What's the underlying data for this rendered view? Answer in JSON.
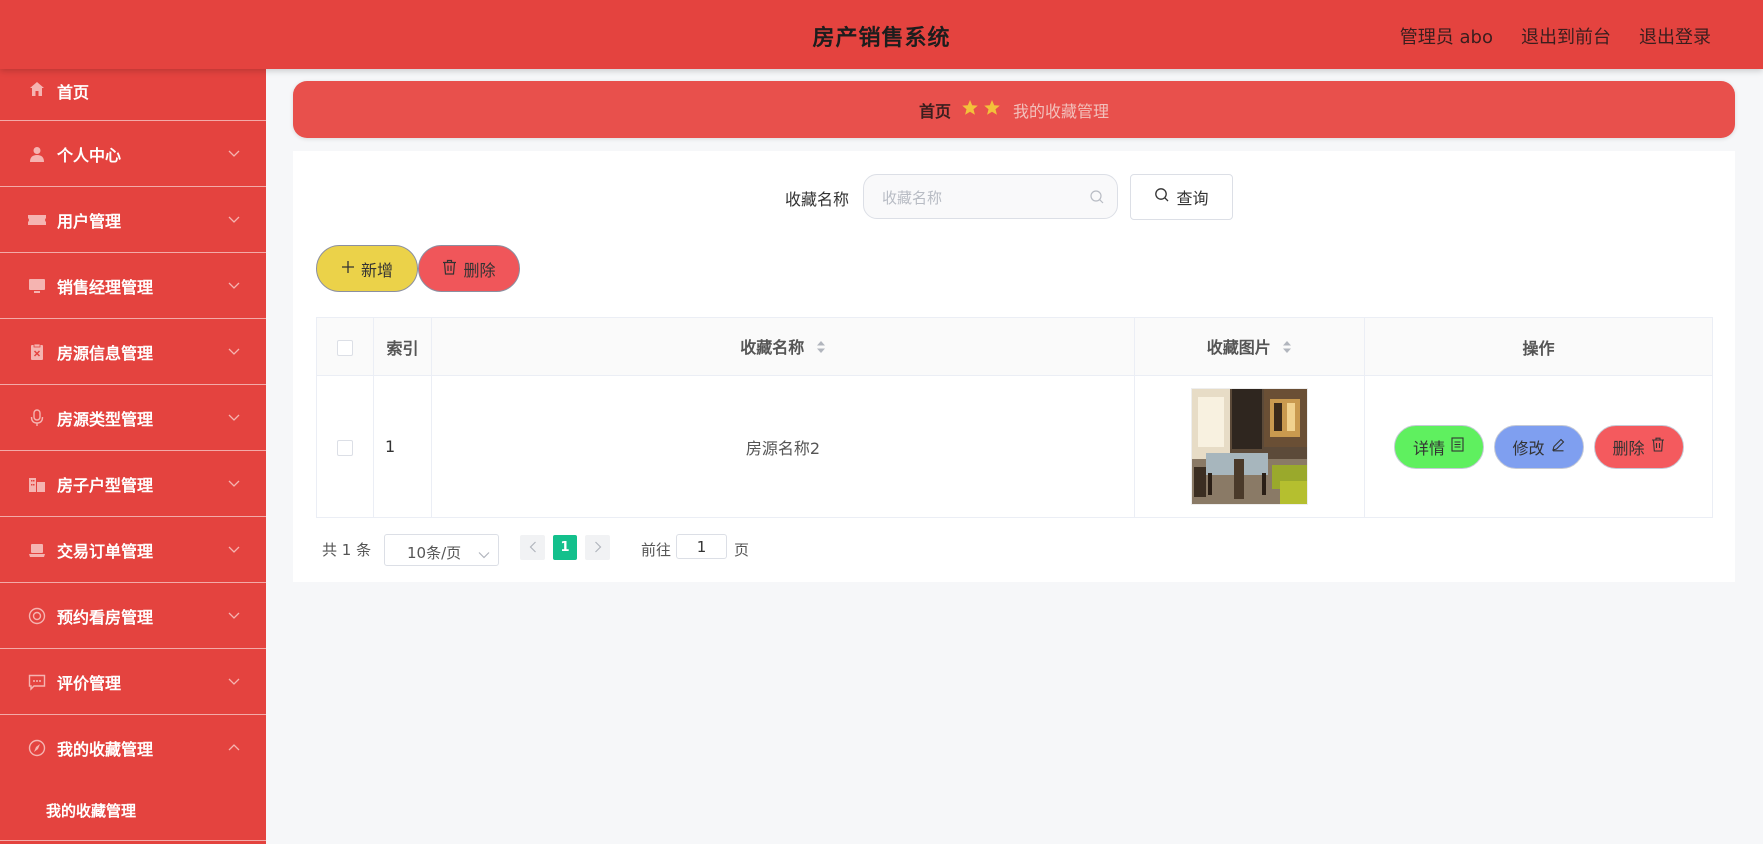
{
  "header": {
    "title": "房产销售系统",
    "admin_label": "管理员 abo",
    "to_frontend": "退出到前台",
    "logout": "退出登录"
  },
  "sidebar": {
    "items": [
      {
        "label": "首页",
        "icon": "home-icon"
      },
      {
        "label": "个人中心",
        "icon": "user-icon"
      },
      {
        "label": "用户管理",
        "icon": "ticket-icon"
      },
      {
        "label": "销售经理管理",
        "icon": "monitor-icon"
      },
      {
        "label": "房源信息管理",
        "icon": "clipboard-x-icon"
      },
      {
        "label": "房源类型管理",
        "icon": "microphone-icon"
      },
      {
        "label": "房子户型管理",
        "icon": "building-icon"
      },
      {
        "label": "交易订单管理",
        "icon": "laptop-icon"
      },
      {
        "label": "预约看房管理",
        "icon": "lifebuoy-icon"
      },
      {
        "label": "评价管理",
        "icon": "chat-icon"
      },
      {
        "label": "我的收藏管理",
        "icon": "compass-icon"
      }
    ],
    "subitem": "我的收藏管理"
  },
  "breadcrumb": {
    "home": "首页",
    "current": "我的收藏管理"
  },
  "search": {
    "label": "收藏名称",
    "placeholder": "收藏名称",
    "button": "查询"
  },
  "actions": {
    "add": "新增",
    "delete": "删除"
  },
  "table": {
    "columns": [
      "索引",
      "收藏名称",
      "收藏图片",
      "操作"
    ],
    "rows": [
      {
        "index": "1",
        "name": "房源名称2",
        "image": "dining-room-photo"
      }
    ],
    "row_actions": {
      "detail": "详情",
      "edit": "修改",
      "delete": "删除"
    }
  },
  "pagination": {
    "total": "共 1 条",
    "page_size": "10条/页",
    "current_page": "1",
    "goto_label": "前往",
    "goto_value": "1",
    "page_suffix": "页"
  },
  "colors": {
    "primary_red": "#e4433f",
    "add_yellow": "#ebd249",
    "detail_green": "#5ff05f",
    "edit_blue": "#7f9ff0",
    "delete_red": "#f45a5e",
    "page_active": "#13c08c"
  }
}
